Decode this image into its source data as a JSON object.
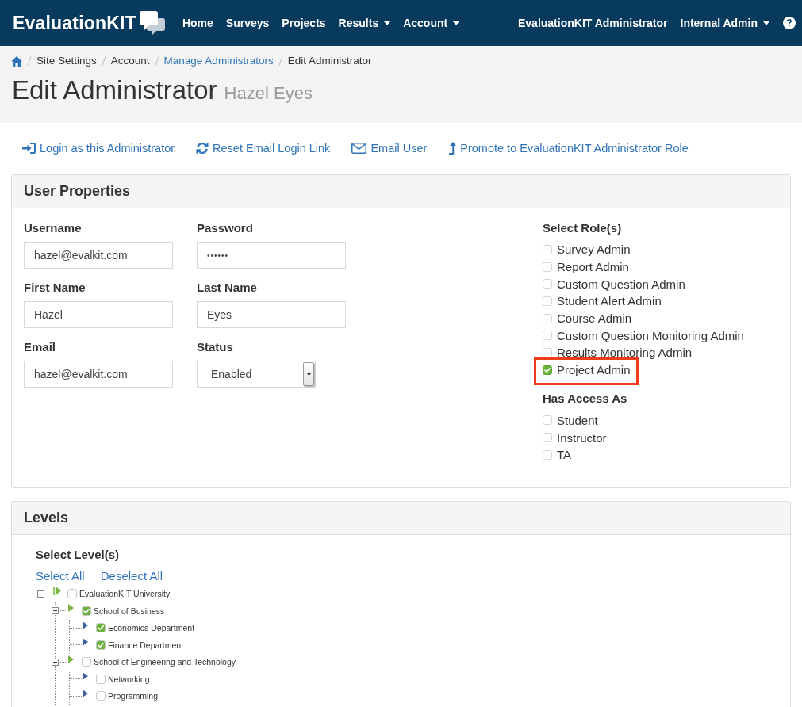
{
  "navbar": {
    "logo": "EvaluationKIT",
    "links": [
      {
        "label": "Home",
        "dropdown": false
      },
      {
        "label": "Surveys",
        "dropdown": false
      },
      {
        "label": "Projects",
        "dropdown": false
      },
      {
        "label": "Results",
        "dropdown": true
      },
      {
        "label": "Account",
        "dropdown": true
      }
    ],
    "user_links": [
      {
        "label": "EvaluationKIT Administrator",
        "dropdown": false
      },
      {
        "label": "Internal Admin",
        "dropdown": true
      }
    ],
    "help": "?"
  },
  "breadcrumb": [
    {
      "label": "Site Settings",
      "link": false
    },
    {
      "label": "Account",
      "link": false
    },
    {
      "label": "Manage Administrators",
      "link": true
    },
    {
      "label": "Edit Administrator",
      "link": false
    }
  ],
  "page_header": {
    "title": "Edit Administrator",
    "subtitle": "Hazel Eyes"
  },
  "actions": [
    {
      "label": "Login as this Administrator"
    },
    {
      "label": "Reset Email Login Link"
    },
    {
      "label": "Email User"
    },
    {
      "label": "Promote to EvaluationKIT Administrator Role"
    }
  ],
  "user_properties": {
    "title": "User Properties",
    "fields": [
      {
        "label": "Username",
        "value": "hazel@evalkit.com",
        "kind": "text"
      },
      {
        "label": "Password",
        "value": "••••••",
        "kind": "password"
      },
      {
        "label": "First Name",
        "value": "Hazel",
        "kind": "text"
      },
      {
        "label": "Last Name",
        "value": "Eyes",
        "kind": "text"
      },
      {
        "label": "Email",
        "value": "hazel@evalkit.com",
        "kind": "text"
      },
      {
        "label": "Status",
        "value": "Enabled",
        "kind": "select"
      }
    ],
    "roles": {
      "title": "Select Role(s)",
      "items": [
        {
          "label": "Survey Admin",
          "checked": false,
          "highlighted": false
        },
        {
          "label": "Report Admin",
          "checked": false,
          "highlighted": false
        },
        {
          "label": "Custom Question Admin",
          "checked": false,
          "highlighted": false
        },
        {
          "label": "Student Alert Admin",
          "checked": false,
          "highlighted": false
        },
        {
          "label": "Course Admin",
          "checked": false,
          "highlighted": false
        },
        {
          "label": "Custom Question Monitoring Admin",
          "checked": false,
          "highlighted": false
        },
        {
          "label": "Results Monitoring Admin",
          "checked": false,
          "highlighted": false
        },
        {
          "label": "Project Admin",
          "checked": true,
          "highlighted": true
        }
      ]
    },
    "access": {
      "title": "Has Access As",
      "items": [
        {
          "label": "Student",
          "checked": false
        },
        {
          "label": "Instructor",
          "checked": false
        },
        {
          "label": "TA",
          "checked": false
        }
      ]
    }
  },
  "levels": {
    "title": "Levels",
    "subtitle": "Select Level(s)",
    "links": [
      {
        "label": "Select All"
      },
      {
        "label": "Deselect All"
      }
    ],
    "tree": [
      {
        "label": "EvaluationKIT University",
        "kind": "root",
        "checked": false,
        "expanded": true,
        "children": [
          {
            "label": "School of Business",
            "kind": "group",
            "checked": true,
            "expanded": true,
            "children": [
              {
                "label": "Economics Department",
                "kind": "leaf",
                "checked": true
              },
              {
                "label": "Finance Department",
                "kind": "leaf",
                "checked": true
              }
            ]
          },
          {
            "label": "School of Engineering and Technology",
            "kind": "group",
            "checked": false,
            "expanded": true,
            "children": [
              {
                "label": "Networking",
                "kind": "leaf",
                "checked": false
              },
              {
                "label": "Programming",
                "kind": "leaf",
                "checked": false
              }
            ]
          }
        ]
      }
    ]
  }
}
